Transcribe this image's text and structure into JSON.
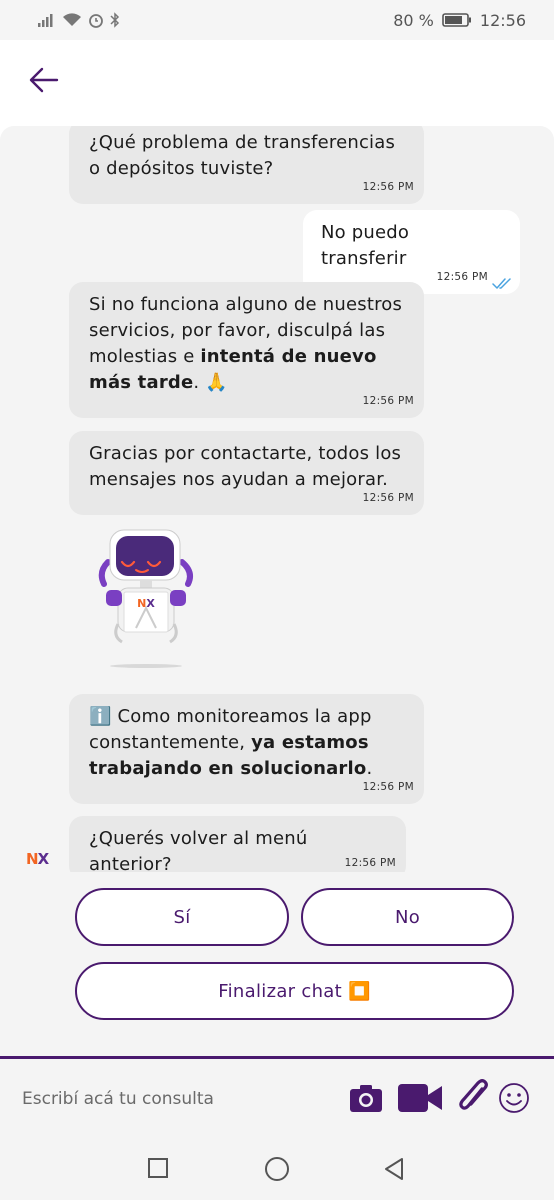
{
  "status_bar": {
    "battery": "80 %",
    "time": "12:56"
  },
  "messages": [
    {
      "id": "m1",
      "from": "bot",
      "text": "¿Qué problema de transferencias o depósitos tuviste?",
      "time": "12:56 PM"
    },
    {
      "id": "m2",
      "from": "user",
      "text": "No puedo transferir",
      "time": "12:56 PM"
    },
    {
      "id": "m3",
      "from": "bot",
      "text_parts": [
        "Si no funciona alguno de nuestros servicios, por favor, disculpá las molestias e ",
        "intentá de nuevo más tarde",
        ". 🙏"
      ],
      "time": "12:56 PM"
    },
    {
      "id": "m4",
      "from": "bot",
      "text": "Gracias por contactarte, todos los mensajes nos ayudan a mejorar.",
      "time": "12:56 PM"
    },
    {
      "id": "m5",
      "from": "bot",
      "text_parts": [
        "ℹ️ Como monitoreamos la app constantemente, ",
        "ya estamos trabajando en solucionarlo",
        "."
      ],
      "time": "12:56 PM"
    },
    {
      "id": "m6",
      "from": "bot",
      "text": "¿Querés volver al menú anterior?",
      "time": "12:56 PM"
    }
  ],
  "robot_sticker": {
    "badge": "NX"
  },
  "avatar": {
    "letters": [
      "N",
      "X"
    ]
  },
  "choices": {
    "yes": "Sí",
    "no": "No",
    "end_chat": "Finalizar chat ⏹️"
  },
  "input": {
    "placeholder": "Escribí acá tu consulta"
  },
  "colors": {
    "brand_purple": "#4a1a6e",
    "bubble_gray": "#e8e8e8",
    "nx_orange": "#f26522",
    "nx_purple": "#5b2d8e",
    "read_check": "#4aa3e0"
  }
}
